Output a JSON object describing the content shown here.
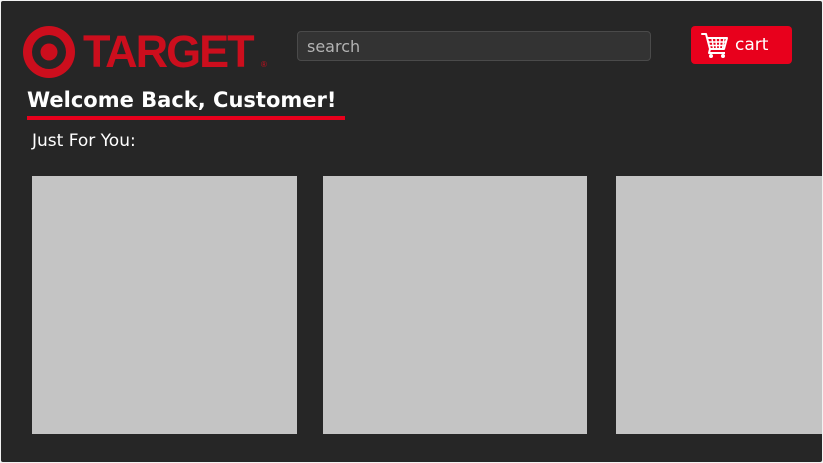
{
  "brand": {
    "name": "TARGET",
    "registered_mark": "®",
    "color": "#cc0e1d"
  },
  "header": {
    "search": {
      "placeholder": "search",
      "value": ""
    },
    "cart": {
      "label": "cart",
      "icon": "shopping-cart-icon",
      "color": "#e8001c"
    }
  },
  "main": {
    "welcome_text": "Welcome Back, Customer!",
    "section_title": "Just For You:",
    "products": [
      {
        "image": "placeholder"
      },
      {
        "image": "placeholder"
      },
      {
        "image": "placeholder"
      }
    ]
  },
  "theme": {
    "background": "#262626",
    "accent": "#e8001c",
    "card_placeholder": "#c4c4c4"
  }
}
